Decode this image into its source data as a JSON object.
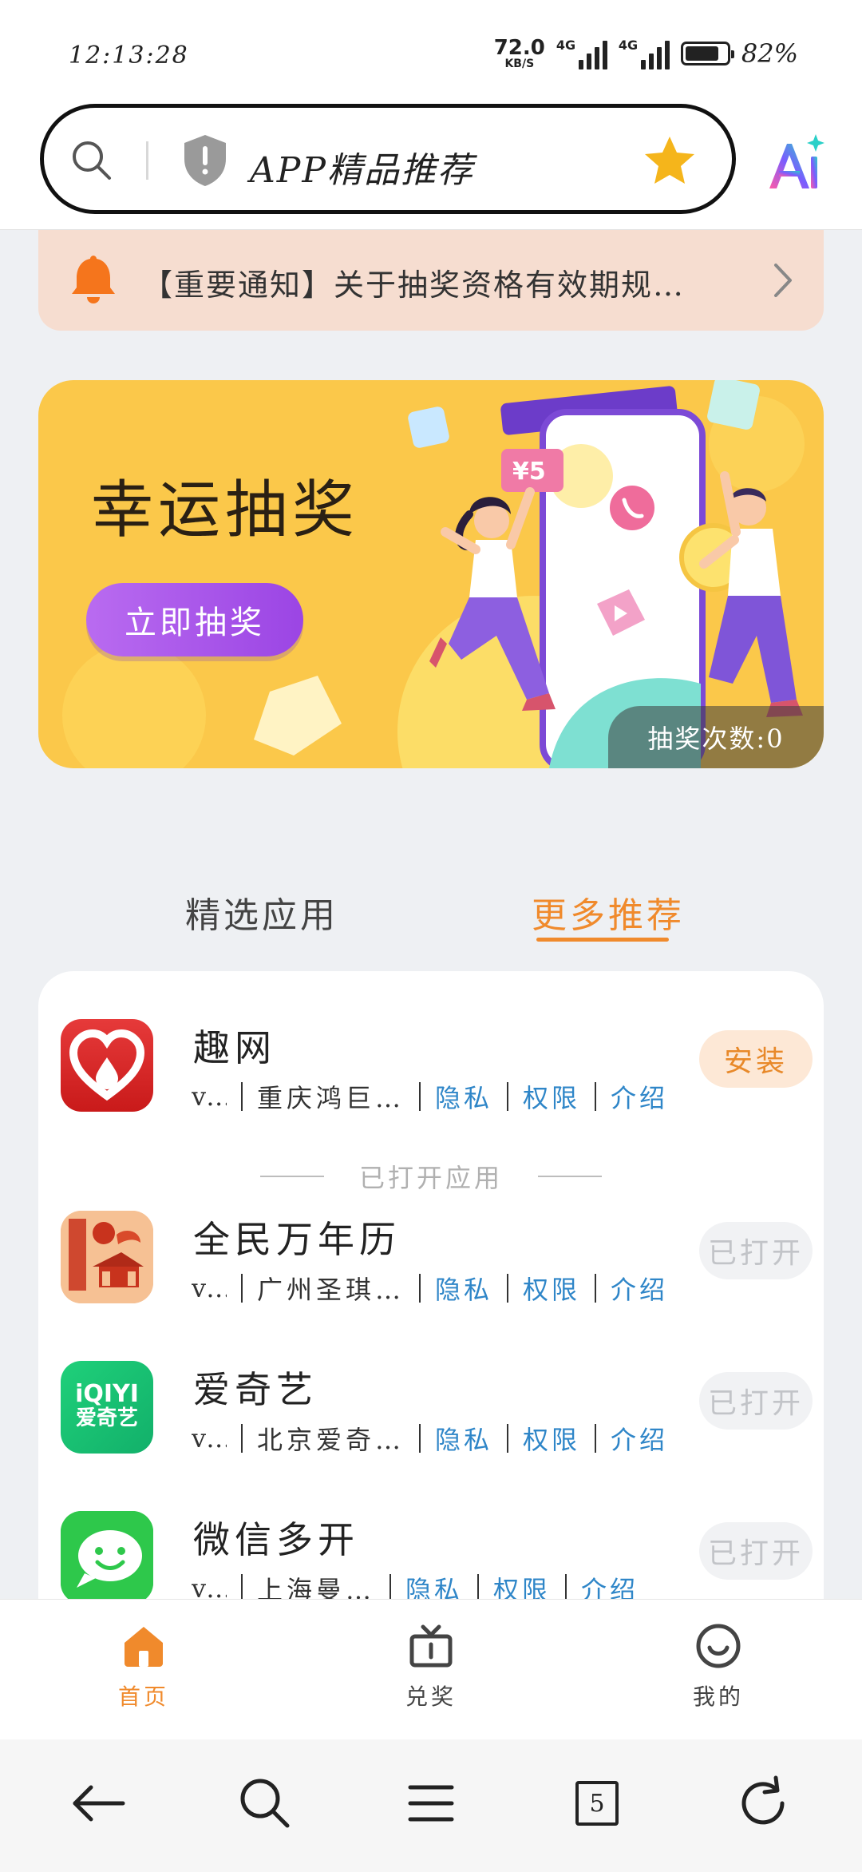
{
  "status_bar": {
    "time": "12:13:28",
    "net_speed_value": "72.0",
    "net_speed_unit": "KB/S",
    "signal1_label": "4G",
    "signal2_label": "4G",
    "battery_percent": "82%",
    "battery_level": 0.82
  },
  "search": {
    "text": "APP精品推荐"
  },
  "notice": {
    "text": "【重要通知】关于抽奖资格有效期规…"
  },
  "banner": {
    "title": "幸运抽奖",
    "button_label": "立即抽奖",
    "draw_count": "抽奖次数:0",
    "price_tag": "¥5"
  },
  "tabs": {
    "featured": "精选应用",
    "more": "更多推荐"
  },
  "apps": [
    {
      "name": "趣网",
      "version": "v…",
      "developer": "重庆鸿巨…",
      "privacy": "隐私",
      "permissions": "权限",
      "intro": "介绍",
      "action": "安装",
      "state": "install"
    },
    {
      "name": "全民万年历",
      "version": "v…",
      "developer": "广州圣琪…",
      "privacy": "隐私",
      "permissions": "权限",
      "intro": "介绍",
      "action": "已打开",
      "state": "opened"
    },
    {
      "name": "爱奇艺",
      "version": "v…",
      "developer": "北京爱奇…",
      "privacy": "隐私",
      "permissions": "权限",
      "intro": "介绍",
      "action": "已打开",
      "state": "opened",
      "icon_text_top": "iQIYI",
      "icon_text_bottom": "爱奇艺"
    },
    {
      "name": "微信多开",
      "version": "v…",
      "developer": "上海曼…",
      "privacy": "隐私",
      "permissions": "权限",
      "intro": "介绍",
      "action": "已打开",
      "state": "opened"
    }
  ],
  "opened_divider": "已打开应用",
  "bottom_nav": {
    "home": "首页",
    "redeem": "兑奖",
    "mine": "我的"
  },
  "system_nav": {
    "tabs_count": "5"
  },
  "colors": {
    "accent": "#f08a2c",
    "link": "#2f86c8",
    "banner_bg": "#fbc84a",
    "button_purple": "#a655ea"
  }
}
